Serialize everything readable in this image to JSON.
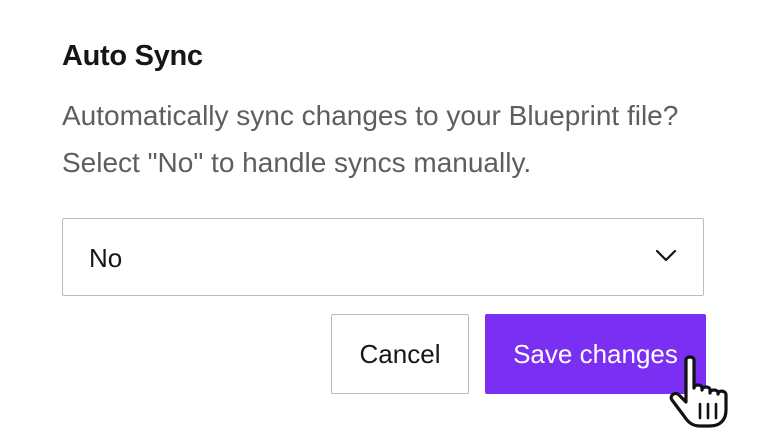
{
  "setting": {
    "title": "Auto Sync",
    "description": "Automatically sync changes to your Blueprint file? Select \"No\" to handle syncs manually."
  },
  "select": {
    "value": "No",
    "icon": "chevron-down-icon"
  },
  "actions": {
    "cancel_label": "Cancel",
    "save_label": "Save changes"
  },
  "colors": {
    "accent": "#7a2ff2",
    "text": "#161616",
    "muted_text": "#5e5e5e",
    "border": "#bdbdbd"
  },
  "cursor": {
    "icon": "hand-pointer-icon"
  }
}
